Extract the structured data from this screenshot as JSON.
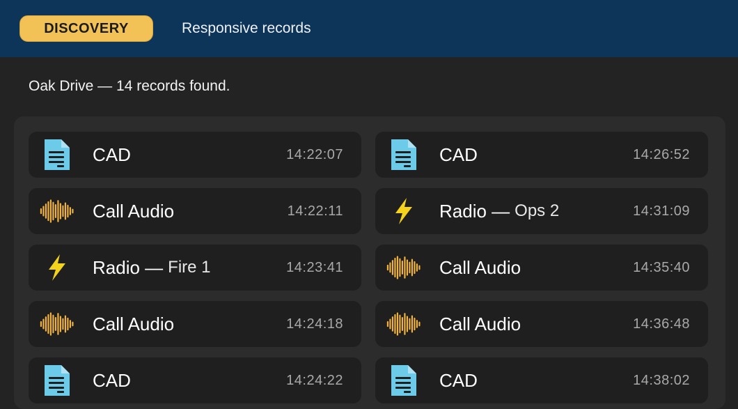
{
  "header": {
    "tab_active": "DISCOVERY",
    "tab_link": "Responsive records"
  },
  "summary": "Oak Drive — 14 records found.",
  "colors": {
    "header_bg": "#0d3459",
    "accent": "#f3c257",
    "doc_icon": "#6ccbe8",
    "audio_icon": "#f3b43c",
    "bolt_icon": "#f5d21c"
  },
  "records": [
    {
      "type": "cad",
      "icon": "document-icon",
      "title": "CAD",
      "sub": "",
      "time": "14:22:07"
    },
    {
      "type": "cad",
      "icon": "document-icon",
      "title": "CAD",
      "sub": "",
      "time": "14:26:52"
    },
    {
      "type": "audio",
      "icon": "waveform-icon",
      "title": "Call Audio",
      "sub": "",
      "time": "14:22:11"
    },
    {
      "type": "radio",
      "icon": "lightning-icon",
      "title": "Radio —",
      "sub": "Ops 2",
      "time": "14:31:09"
    },
    {
      "type": "radio",
      "icon": "lightning-icon",
      "title": "Radio —",
      "sub": "Fire 1",
      "time": "14:23:41"
    },
    {
      "type": "audio",
      "icon": "waveform-icon",
      "title": "Call Audio",
      "sub": "",
      "time": "14:35:40"
    },
    {
      "type": "audio",
      "icon": "waveform-icon",
      "title": "Call Audio",
      "sub": "",
      "time": "14:24:18"
    },
    {
      "type": "audio",
      "icon": "waveform-icon",
      "title": "Call Audio",
      "sub": "",
      "time": "14:36:48"
    },
    {
      "type": "cad",
      "icon": "document-icon",
      "title": "CAD",
      "sub": "",
      "time": "14:24:22"
    },
    {
      "type": "cad",
      "icon": "document-icon",
      "title": "CAD",
      "sub": "",
      "time": "14:38:02"
    }
  ]
}
